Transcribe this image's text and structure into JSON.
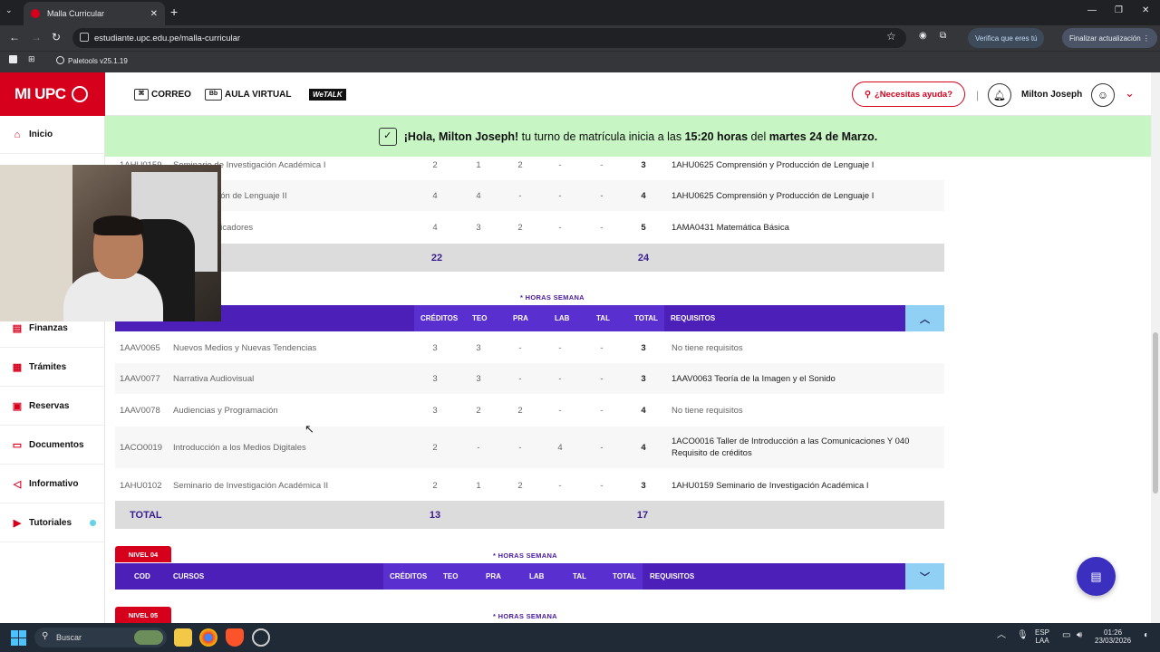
{
  "browser": {
    "tab_title": "Malla Curricular",
    "url": "estudiante.upc.edu.pe/malla-curricular",
    "verify_label": "Verifica que eres tú",
    "update_label": "Finalizar actualización",
    "bookmark": "Paletools v25.1.19"
  },
  "header": {
    "logo": "MI UPC",
    "links": [
      "CORREO",
      "AULA VIRTUAL",
      "WeTALK"
    ],
    "help": "¿Necesitas ayuda?",
    "user": "Milton Joseph"
  },
  "banner": {
    "greeting": "¡Hola, Milton Joseph!",
    "text1": " tu turno de matrícula inicia a las ",
    "time": "15:20 horas",
    "text2": " del ",
    "date": "martes 24 de Marzo."
  },
  "sidebar": {
    "items": [
      {
        "label": "Inicio",
        "icon": "home-icon"
      },
      {
        "label": "Finanzas",
        "icon": "wallet-icon"
      },
      {
        "label": "Trámites",
        "icon": "document-icon"
      },
      {
        "label": "Reservas",
        "icon": "calendar-icon"
      },
      {
        "label": "Documentos",
        "icon": "folder-icon"
      },
      {
        "label": "Informativo",
        "icon": "megaphone-icon"
      },
      {
        "label": "Tutoriales",
        "icon": "video-icon"
      }
    ]
  },
  "table_prev": {
    "rows": [
      {
        "code": "1AHU0159",
        "name": "Seminario de Investigación Académica I",
        "cred": "2",
        "teo": "1",
        "pra": "2",
        "lab": "-",
        "tal": "-",
        "tot": "3",
        "req": "1AHU0625 Comprensión y Producción de Lenguaje I"
      },
      {
        "code": "",
        "name": "n y Producción de Lenguaje II",
        "cred": "4",
        "teo": "4",
        "pra": "-",
        "lab": "-",
        "tal": "-",
        "tot": "4",
        "req": "1AHU0625 Comprensión y Producción de Lenguaje I"
      },
      {
        "code": "",
        "name": "para Comunicadores",
        "cred": "4",
        "teo": "3",
        "pra": "2",
        "lab": "-",
        "tal": "-",
        "tot": "5",
        "req": "1AMA0431 Matemática Básica"
      }
    ],
    "total_cred": "22",
    "total_hours": "24"
  },
  "table_main": {
    "horas_semana": "* HORAS SEMANA",
    "headers": {
      "cod": "COD",
      "cursos": "CURSOS",
      "cred": "CRÉDITOS",
      "teo": "TEO",
      "pra": "PRA",
      "lab": "LAB",
      "tal": "TAL",
      "tot": "TOTAL",
      "req": "REQUISITOS"
    },
    "rows": [
      {
        "code": "1AAV0065",
        "name": "Nuevos Medios y Nuevas Tendencias",
        "cred": "3",
        "teo": "3",
        "pra": "-",
        "lab": "-",
        "tal": "-",
        "tot": "3",
        "req": "No tiene requisitos"
      },
      {
        "code": "1AAV0077",
        "name": "Narrativa Audiovisual",
        "cred": "3",
        "teo": "3",
        "pra": "-",
        "lab": "-",
        "tal": "-",
        "tot": "3",
        "req": "1AAV0063 Teoría de la Imagen y el Sonido"
      },
      {
        "code": "1AAV0078",
        "name": "Audiencias y Programación",
        "cred": "3",
        "teo": "2",
        "pra": "2",
        "lab": "-",
        "tal": "-",
        "tot": "4",
        "req": "No tiene requisitos"
      },
      {
        "code": "1ACO0019",
        "name": "Introducción a los Medios Digitales",
        "cred": "2",
        "teo": "-",
        "pra": "-",
        "lab": "4",
        "tal": "-",
        "tot": "4",
        "req": "1ACO0016 Taller de Introducción a las Comunicaciones Y 040 Requisito de créditos"
      },
      {
        "code": "1AHU0102",
        "name": "Seminario de Investigación Académica II",
        "cred": "2",
        "teo": "1",
        "pra": "2",
        "lab": "-",
        "tal": "-",
        "tot": "3",
        "req": "1AHU0159 Seminario de Investigación Académica I"
      }
    ],
    "total_label": "TOTAL",
    "total_cred": "13",
    "total_hours": "17"
  },
  "nivel04": {
    "badge": "NIVEL 04",
    "horas_semana": "* HORAS SEMANA"
  },
  "nivel05": {
    "badge": "NIVEL 05",
    "horas_semana": "* HORAS SEMANA"
  },
  "taskbar": {
    "search": "Buscar",
    "lang1": "ESP",
    "lang2": "LAA",
    "time": "01:26",
    "date": "23/03/2026"
  },
  "colors": {
    "brand_red": "#d6001c",
    "header_purple": "#4b1fb8",
    "banner_green": "#c7f5c4"
  }
}
